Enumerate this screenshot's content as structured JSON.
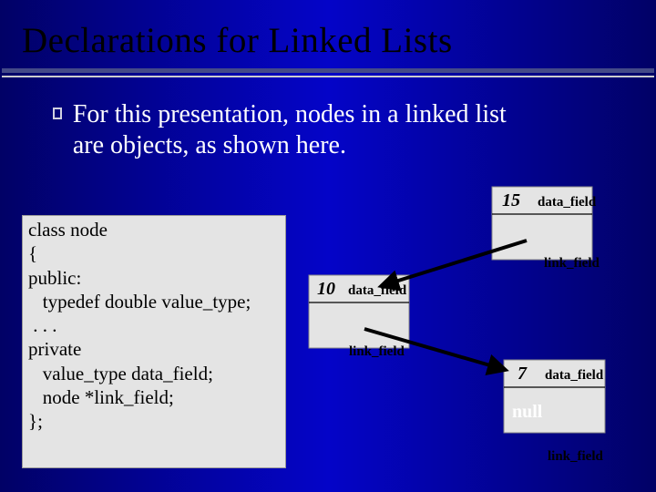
{
  "title": "Declarations for Linked Lists",
  "bullet": "For this presentation, nodes in a linked list are objects, as shown here.",
  "code": "class node\n{\npublic:\n   typedef double value_type;\n . . .\nprivate\n   value_type data_field;\n   node *link_field;\n};",
  "labels": {
    "data_field": "data_field",
    "link_field": "link_field",
    "null": "null"
  },
  "nodes": {
    "a": {
      "value": "15"
    },
    "b": {
      "value": "10"
    },
    "c": {
      "value": "7"
    }
  }
}
